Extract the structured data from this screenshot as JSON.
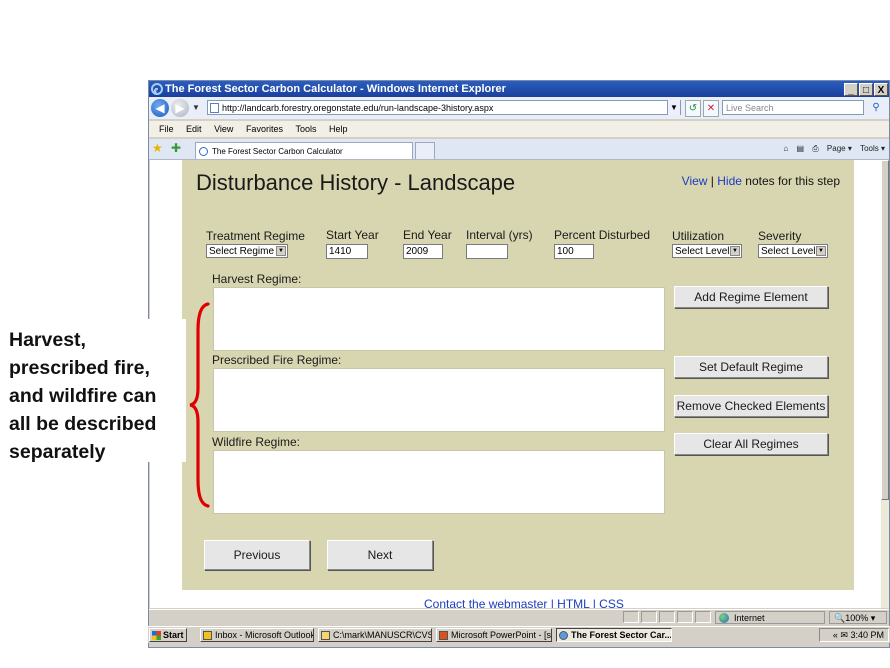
{
  "browser": {
    "title": "The Forest Sector Carbon Calculator - Windows Internet Explorer",
    "window_buttons": [
      "_",
      "□",
      "X"
    ],
    "url": "http://landcarb.forestry.oregonstate.edu/run-landscape-3history.aspx",
    "search_placeholder": "Live Search",
    "menu": [
      "File",
      "Edit",
      "View",
      "Favorites",
      "Tools",
      "Help"
    ],
    "tab_title": "The Forest Sector Carbon Calculator",
    "commands": [
      "Page ▾",
      "Tools ▾"
    ],
    "status_zone": "Internet",
    "zoom": "100%"
  },
  "page": {
    "title": "Disturbance History - Landscape",
    "notes_view": "View",
    "notes_sep": " | ",
    "notes_hide": "Hide",
    "notes_suffix": " notes for this step",
    "fields": {
      "treatment_label": "Treatment Regime",
      "treatment_value": "Select Regime",
      "start_label": "Start Year",
      "start_value": "1410",
      "end_label": "End Year",
      "end_value": "2009",
      "interval_label": "Interval (yrs)",
      "interval_value": "",
      "percent_label": "Percent Disturbed",
      "percent_value": "100",
      "utilization_label": "Utilization",
      "utilization_value": "Select Level",
      "severity_label": "Severity",
      "severity_value": "Select Level"
    },
    "regimes": {
      "harvest": "Harvest Regime:",
      "prescribed": "Prescribed Fire Regime:",
      "wildfire": "Wildfire Regime:"
    },
    "buttons": {
      "add": "Add Regime Element",
      "default": "Set Default Regime",
      "remove": "Remove Checked Elements",
      "clear": "Clear All Regimes",
      "previous": "Previous",
      "next": "Next"
    },
    "footer": "Contact the webmaster | HTML | CSS"
  },
  "taskbar": {
    "start": "Start",
    "tasks": [
      "Inbox - Microsoft Outlook",
      "C:\\mark\\MANUSCR\\CVS",
      "Microsoft PowerPoint - [s...",
      "The Forest Sector Car..."
    ],
    "tray_chevron": "«",
    "clock": "3:40 PM"
  },
  "callout": {
    "text": "Harvest,\nprescribed fire,\nand wildfire can\nall be described\nseparately",
    "brace_color": "#e00000"
  }
}
